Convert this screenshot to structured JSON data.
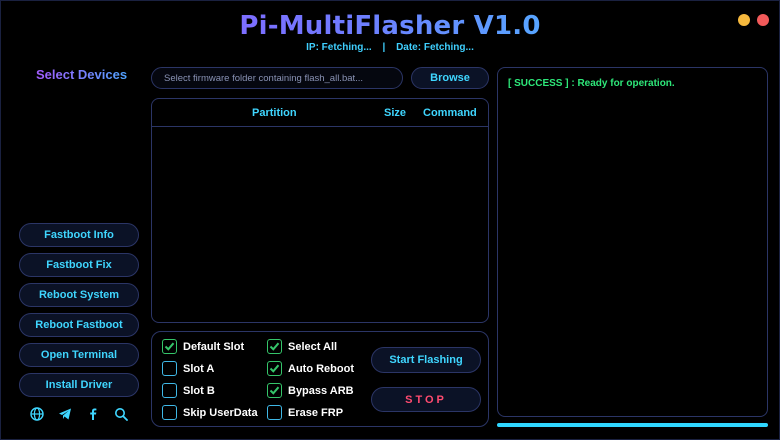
{
  "app": {
    "title": "Pi-MultiFlasher V1.0",
    "ip": "IP: Fetching...",
    "separator": "|",
    "date": "Date: Fetching..."
  },
  "sidebar": {
    "select_devices": "Select Devices",
    "buttons": [
      "Fastboot Info",
      "Fastboot Fix",
      "Reboot System",
      "Reboot Fastboot",
      "Open Terminal",
      "Install Driver"
    ],
    "icons": [
      "globe-icon",
      "telegram-icon",
      "facebook-icon",
      "search-icon"
    ]
  },
  "firmware": {
    "placeholder": "Select firmware folder containing flash_all.bat...",
    "browse_label": "Browse"
  },
  "table": {
    "columns": [
      "Partition",
      "Size",
      "Command"
    ],
    "rows": []
  },
  "options": {
    "default_slot": {
      "label": "Default Slot",
      "checked": true
    },
    "slot_a": {
      "label": "Slot A",
      "checked": false
    },
    "slot_b": {
      "label": "Slot B",
      "checked": false
    },
    "skip_userdata": {
      "label": "Skip UserData",
      "checked": false
    },
    "select_all": {
      "label": "Select All",
      "checked": true
    },
    "auto_reboot": {
      "label": "Auto Reboot",
      "checked": true
    },
    "bypass_arb": {
      "label": "Bypass ARB",
      "checked": true
    },
    "erase_frp": {
      "label": "Erase FRP",
      "checked": false
    }
  },
  "actions": {
    "start_label": "Start Flashing",
    "stop_label": "STOP"
  },
  "log": {
    "line": "[ SUCCESS ] : Ready for operation."
  },
  "progress": 1.0,
  "colors": {
    "accent": "#3fd6ff",
    "success": "#2ee87a",
    "stop": "#ff4b70",
    "checkbox_checked": "#35c56a"
  }
}
